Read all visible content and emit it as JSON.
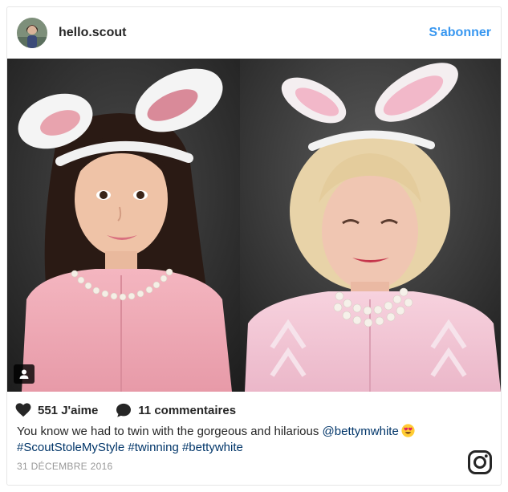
{
  "post": {
    "username": "hello.scout",
    "follow_label": "S'abonner",
    "likes_label": "551 J'aime",
    "comments_label": "11 commentaires",
    "caption_text": "You know we had to twin with the gorgeous and hilarious ",
    "mention": "@bettymwhite",
    "hashtags": [
      "#ScoutStoleMyStyle",
      "#twinning",
      "#bettywhite"
    ],
    "date": "31 DÉCEMBRE 2016"
  },
  "icons": {
    "like": "heart-icon",
    "comment": "comment-icon",
    "tag": "user-tag-icon",
    "emoji": "heart-eyes-emoji",
    "brand": "instagram-icon"
  },
  "colors": {
    "link": "#3897f0",
    "hashtag": "#003569",
    "text": "#262626",
    "muted": "#999999"
  }
}
